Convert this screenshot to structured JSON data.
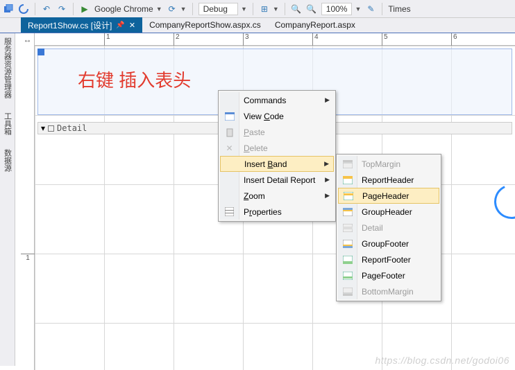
{
  "toolbar": {
    "browser": "Google Chrome",
    "config": "Debug",
    "zoom": "100%",
    "font_hint": "Times"
  },
  "tabs": [
    {
      "label": "Report1Show.cs [设计]",
      "active": true
    },
    {
      "label": "CompanyReportShow.aspx.cs",
      "active": false
    },
    {
      "label": "CompanyReport.aspx",
      "active": false
    }
  ],
  "side_panels": [
    "服务器资源管理器",
    "工具箱",
    "数据源"
  ],
  "ruler_marks": [
    "1",
    "2",
    "3",
    "4",
    "5",
    "6"
  ],
  "ruler_v_marks": [
    "1"
  ],
  "detail_label": "Detail",
  "annotation": "右键 插入表头",
  "context_menu": {
    "items": [
      {
        "label": "Commands",
        "arrow": true
      },
      {
        "label": "View Code",
        "underline": "C",
        "icon": "code-icon"
      },
      {
        "label": "Paste",
        "underline": "P",
        "disabled": true,
        "icon": "paste-icon"
      },
      {
        "label": "Delete",
        "underline": "D",
        "disabled": true,
        "icon": "delete-icon"
      },
      {
        "label": "Insert Band",
        "underline": "B",
        "arrow": true,
        "selected": true
      },
      {
        "label": "Insert Detail Report",
        "arrow": true
      },
      {
        "label": "Zoom",
        "underline": "Z",
        "arrow": true
      },
      {
        "label": "Properties",
        "underline": "r",
        "icon": "properties-icon"
      }
    ]
  },
  "submenu": {
    "items": [
      {
        "label": "TopMargin",
        "disabled": true,
        "icon": "band-top-icon"
      },
      {
        "label": "ReportHeader",
        "icon": "band-rh-icon"
      },
      {
        "label": "PageHeader",
        "selected": true,
        "icon": "band-ph-icon"
      },
      {
        "label": "GroupHeader",
        "icon": "band-gh-icon"
      },
      {
        "label": "Detail",
        "disabled": true,
        "icon": "band-detail-icon"
      },
      {
        "label": "GroupFooter",
        "icon": "band-gf-icon"
      },
      {
        "label": "ReportFooter",
        "icon": "band-rf-icon"
      },
      {
        "label": "PageFooter",
        "icon": "band-pf-icon"
      },
      {
        "label": "BottomMargin",
        "disabled": true,
        "icon": "band-bottom-icon"
      }
    ]
  },
  "watermark": "https://blog.csdn.net/godoi06"
}
